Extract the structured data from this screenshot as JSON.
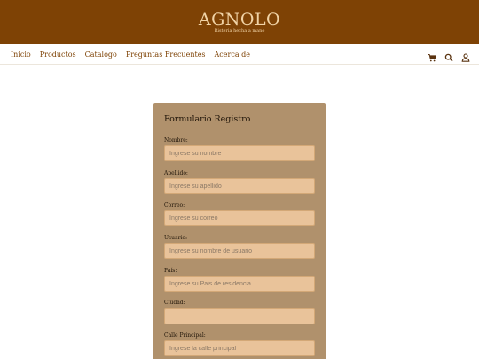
{
  "header": {
    "brand": "AGNOLO",
    "tagline": "Risteria hecha a mano"
  },
  "nav": {
    "links": [
      "Inicio",
      "Productos",
      "Catalogo",
      "Preguntas Frecuentes",
      "Acerca de"
    ],
    "icons": [
      "cart-icon",
      "search-icon",
      "user-icon"
    ]
  },
  "form": {
    "title": "Formulario Registro",
    "fields": [
      {
        "label": "Nombre:",
        "placeholder": "Ingrese su nombre",
        "value": ""
      },
      {
        "label": "Apellido:",
        "placeholder": "Ingrese su apellido",
        "value": ""
      },
      {
        "label": "Correo:",
        "placeholder": "Ingrese su correo",
        "value": ""
      },
      {
        "label": "Usuario:",
        "placeholder": "Ingrese su nombre de usuario",
        "value": ""
      },
      {
        "label": "País:",
        "placeholder": "Ingrese su Pais de residencia",
        "value": ""
      },
      {
        "label": "Ciudad:",
        "placeholder": "",
        "value": ""
      },
      {
        "label": "Calle Principal:",
        "placeholder": "Ingrese la calle principal",
        "value": ""
      }
    ]
  },
  "colors": {
    "header_bg": "#7e4205",
    "card_bg": "#b0916c",
    "input_bg": "#e9c39a",
    "accent_text": "#7e4205"
  }
}
